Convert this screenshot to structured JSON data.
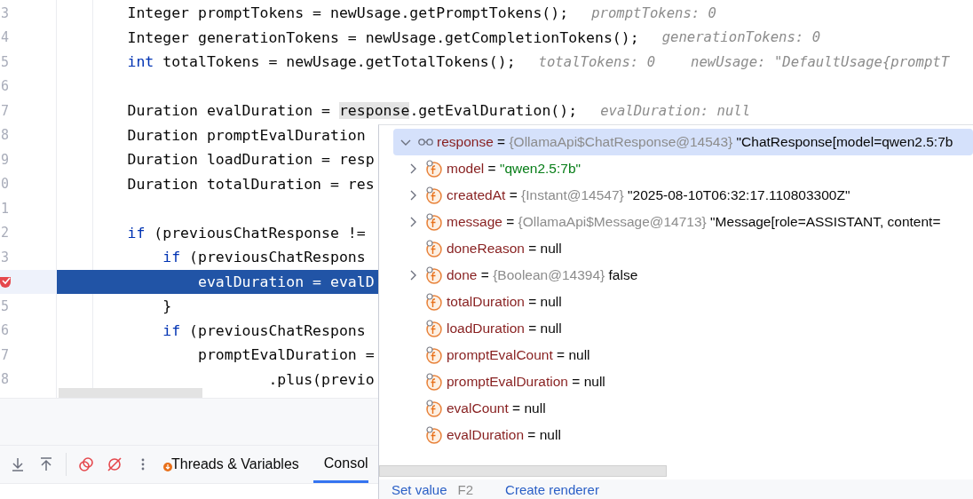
{
  "editor": {
    "lines": [
      {
        "number": "3",
        "current": false,
        "tokens": [
          {
            "kind": "code",
            "text": "        Integer promptTokens = newUsage.getPromptTokens();"
          },
          {
            "kind": "hint",
            "text": "promptTokens: 0"
          }
        ]
      },
      {
        "number": "4",
        "current": false,
        "tokens": [
          {
            "kind": "code",
            "text": "        Integer generationTokens = newUsage.getCompletionTokens();"
          },
          {
            "kind": "hint",
            "text": "generationTokens: 0"
          }
        ]
      },
      {
        "number": "5",
        "current": false,
        "tokens": [
          {
            "kind": "keyword",
            "text": "        int"
          },
          {
            "kind": "code",
            "text": " totalTokens = newUsage.getTotalTokens();"
          },
          {
            "kind": "hint",
            "text": "totalTokens: 0"
          },
          {
            "kind": "hint",
            "text": "newUsage: \"DefaultUsage{promptT"
          }
        ]
      },
      {
        "number": "6",
        "current": false
      },
      {
        "number": "7",
        "current": false,
        "tokens": [
          {
            "kind": "code",
            "text": "        Duration evalDuration = "
          },
          {
            "kind": "ref",
            "text": "response"
          },
          {
            "kind": "code",
            "text": ".getEvalDuration();"
          },
          {
            "kind": "hint",
            "text": "evalDuration: null"
          }
        ]
      },
      {
        "number": "8",
        "current": false,
        "tokens": [
          {
            "kind": "code",
            "text": "        Duration promptEvalDuration"
          }
        ]
      },
      {
        "number": "9",
        "current": false,
        "tokens": [
          {
            "kind": "code",
            "text": "        Duration loadDuration = resp"
          }
        ]
      },
      {
        "number": "0",
        "current": false,
        "tokens": [
          {
            "kind": "code",
            "text": "        Duration totalDuration = res"
          }
        ]
      },
      {
        "number": "1",
        "current": false
      },
      {
        "number": "2",
        "current": false,
        "tokens": [
          {
            "kind": "keyword",
            "text": "        if"
          },
          {
            "kind": "code",
            "text": " (previousChatResponse !="
          }
        ]
      },
      {
        "number": "3",
        "current": false,
        "tokens": [
          {
            "kind": "keyword",
            "text": "            if"
          },
          {
            "kind": "code",
            "text": " (previousChatRespons"
          }
        ]
      },
      {
        "current": true,
        "breakpoint": true,
        "tokens": [
          {
            "kind": "code",
            "text": "                evalDuration = evalD"
          }
        ]
      },
      {
        "number": "5",
        "current": false,
        "tokens": [
          {
            "kind": "code",
            "text": "            }"
          }
        ]
      },
      {
        "number": "6",
        "current": false,
        "tokens": [
          {
            "kind": "keyword",
            "text": "            if"
          },
          {
            "kind": "code",
            "text": " (previousChatRespons"
          }
        ]
      },
      {
        "number": "7",
        "current": false,
        "tokens": [
          {
            "kind": "code",
            "text": "                promptEvalDuration ="
          }
        ]
      },
      {
        "number": "8",
        "current": false,
        "tokens": [
          {
            "kind": "code",
            "text": "                        .plus(previo"
          }
        ]
      }
    ]
  },
  "toolbar": {
    "tabs": [
      {
        "label": "Threads & Variables",
        "selected": false
      },
      {
        "label": "Consol",
        "selected": true
      }
    ]
  },
  "popup": {
    "tree": [
      {
        "name": "response",
        "op": "=",
        "type": "{OllamaApi$ChatResponse@14543}",
        "value": "\"ChatResponse[model=qwen2.5:7b",
        "expanded": true,
        "selected": true,
        "children": [
          {
            "name": "model",
            "op": "=",
            "value": "\"qwen2.5:7b\"",
            "kind": "string",
            "expanded": false,
            "selected": false
          },
          {
            "name": "createdAt",
            "op": "=",
            "type": "{Instant@14547}",
            "value": "\"2025-08-10T06:32:17.110803300Z\"",
            "expanded": false,
            "selected": false
          },
          {
            "name": "message",
            "op": "=",
            "type": "{OllamaApi$Message@14713}",
            "value": "\"Message[role=ASSISTANT, content=",
            "expanded": false,
            "selected": false
          },
          {
            "name": "doneReason",
            "op": "=",
            "value": "null",
            "selected": false
          },
          {
            "name": "done",
            "op": "=",
            "type": "{Boolean@14394}",
            "value": "false",
            "expanded": false,
            "selected": false
          },
          {
            "name": "totalDuration",
            "op": "=",
            "value": "null",
            "selected": false
          },
          {
            "name": "loadDuration",
            "op": "=",
            "value": "null",
            "selected": false
          },
          {
            "name": "promptEvalCount",
            "op": "=",
            "value": "null",
            "selected": false
          },
          {
            "name": "promptEvalDuration",
            "op": "=",
            "value": "null",
            "selected": false
          },
          {
            "name": "evalCount",
            "op": "=",
            "value": "null",
            "selected": false
          },
          {
            "name": "evalDuration",
            "op": "=",
            "value": "null",
            "selected": false
          }
        ]
      }
    ],
    "footer": [
      {
        "kind": "link",
        "text": "Set value"
      },
      {
        "kind": "shortcut",
        "text": "F2"
      },
      {
        "kind": "link",
        "text": "Create renderer"
      }
    ]
  }
}
